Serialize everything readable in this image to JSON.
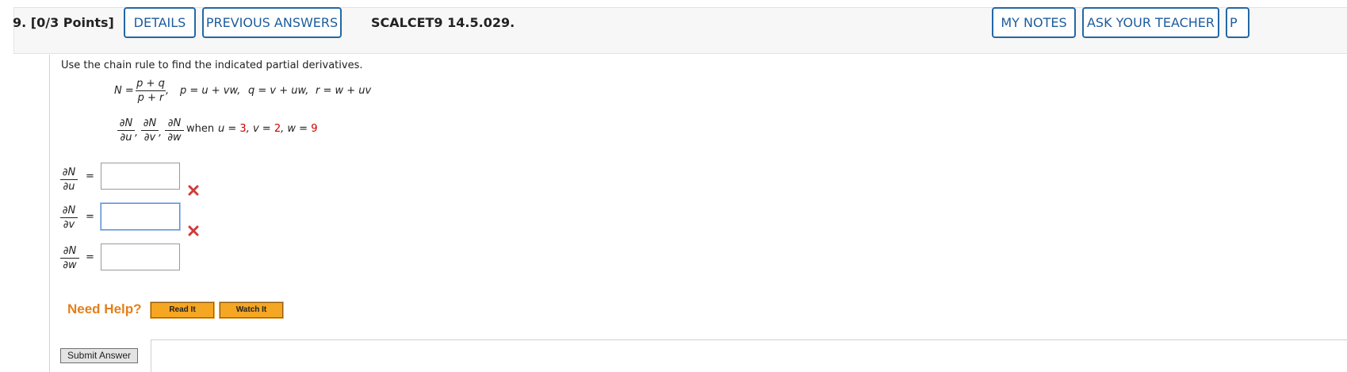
{
  "header": {
    "number": "9.",
    "points": "[0/3 Points]",
    "details_label": "DETAILS",
    "previous_label": "PREVIOUS ANSWERS",
    "code": "SCALCET9 14.5.029.",
    "my_notes_label": "MY NOTES",
    "ask_teacher_label": "ASK YOUR TEACHER",
    "cut_label": "P"
  },
  "question": {
    "instruction": "Use the chain rule to find the indicated partial derivatives.",
    "N_lhs": "N =",
    "N_num": "p + q",
    "N_den": "p + r",
    "comma": ",",
    "p_def": "p = u + vw,",
    "q_def": "q = v + uw,",
    "r_def": "r = w + uv",
    "dN": "∂N",
    "du": "∂u",
    "dv": "∂v",
    "dw": "∂w",
    "when": "when",
    "u_label": "u =",
    "u_val": "3",
    "v_label": "v =",
    "v_val": "2",
    "w_label": "w =",
    "w_val": "9",
    "sep": ","
  },
  "answers": [
    {
      "var": "∂u",
      "value": "",
      "status": "incorrect"
    },
    {
      "var": "∂v",
      "value": "",
      "status": "incorrect"
    },
    {
      "var": "∂w",
      "value": "",
      "status": "none"
    }
  ],
  "equals": "=",
  "help": {
    "label": "Need Help?",
    "read_label": "Read It",
    "watch_label": "Watch It"
  },
  "submit_label": "Submit Answer",
  "colors": {
    "link_blue": "#1c5c9d",
    "help_orange": "#e37f1b",
    "error_red": "#cc0000"
  }
}
